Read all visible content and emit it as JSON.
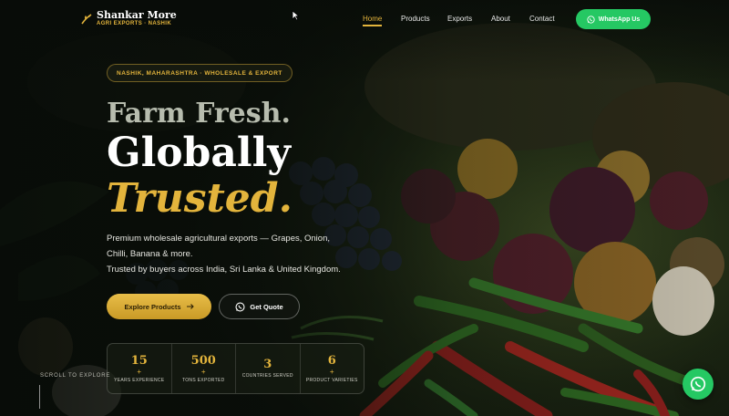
{
  "brand": {
    "name": "Shankar More",
    "tagline": "AGRI EXPORTS · NASHIK"
  },
  "nav": {
    "items": [
      {
        "label": "Home",
        "active": true
      },
      {
        "label": "Products",
        "active": false
      },
      {
        "label": "Exports",
        "active": false
      },
      {
        "label": "About",
        "active": false
      },
      {
        "label": "Contact",
        "active": false
      }
    ],
    "whatsapp_label": "WhatsApp Us"
  },
  "hero": {
    "location": "NASHIK, MAHARASHTRA · WHOLESALE & EXPORT",
    "headline_1": "Farm Fresh.",
    "headline_2": "Globally",
    "headline_3": "Trusted.",
    "description_1": "Premium wholesale agricultural exports — Grapes, Onion,",
    "description_2": "Chilli, Banana & more.",
    "description_3": "Trusted by buyers across India, Sri Lanka & United Kingdom.",
    "primary_button": "Explore Products",
    "secondary_button": "Get Quote"
  },
  "stats": [
    {
      "value": "15",
      "plus": "+",
      "label": "YEARS EXPERIENCE"
    },
    {
      "value": "500",
      "plus": "+",
      "label": "TONS EXPORTED"
    },
    {
      "value": "3",
      "plus": "",
      "label": "COUNTRIES SERVED"
    },
    {
      "value": "6",
      "plus": "+",
      "label": "PRODUCT VARIETIES"
    }
  ],
  "scroll_hint": "SCROLL TO EXPLORE",
  "colors": {
    "accent": "#e3b43c",
    "whatsapp": "#25c863",
    "background": "#10160e"
  },
  "icons": [
    "wheat-logo-icon",
    "whatsapp-icon",
    "arrow-right-icon",
    "cursor-icon"
  ]
}
